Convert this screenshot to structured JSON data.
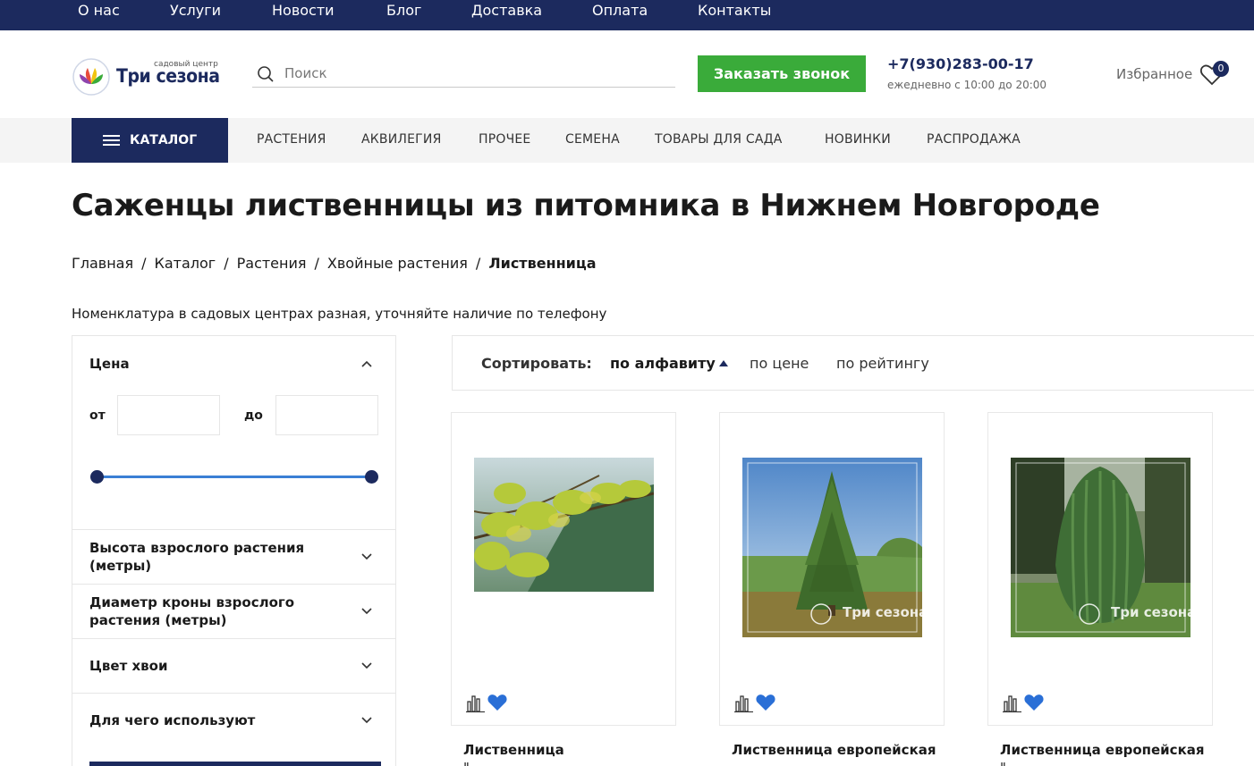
{
  "topnav": {
    "items": [
      "О нас",
      "Услуги",
      "Новости",
      "Блог",
      "Доставка",
      "Оплата",
      "Контакты"
    ]
  },
  "header": {
    "logo_small": "садовый центр",
    "logo_text": "Три сезона",
    "search_placeholder": "Поиск",
    "call_button": "Заказать звонок",
    "phone": "+7(930)283-00-17",
    "hours": "ежедневно с 10:00 до 20:00",
    "favorites_label": "Избранное",
    "favorites_count": "0"
  },
  "catbar": {
    "catalog_label": "КАТАЛОГ",
    "categories": [
      "РАСТЕНИЯ",
      "АКВИЛЕГИЯ",
      "ПРОЧЕЕ",
      "СЕМЕНА",
      "ТОВАРЫ ДЛЯ САДА",
      "НОВИНКИ",
      "РАСПРОДАЖА"
    ]
  },
  "page": {
    "title": "Саженцы лиственницы из питомника в Нижнем Новгороде",
    "breadcrumb": [
      "Главная",
      "Каталог",
      "Растения",
      "Хвойные растения",
      "Лиственница"
    ],
    "notice": "Номенклатура в садовых центрах разная, уточняйте наличие по телефону"
  },
  "filters": {
    "price_title": "Цена",
    "from_label": "от",
    "to_label": "до",
    "from_value": "",
    "to_value": "",
    "groups": [
      "Высота взрослого растения (метры)",
      "Диаметр кроны взрослого растения (метры)",
      "Цвет хвои",
      "Для чего используют"
    ]
  },
  "sort": {
    "label": "Сортировать:",
    "options": [
      "по алфавиту",
      "по цене",
      "по рейтингу"
    ],
    "active": "по алфавиту"
  },
  "products": [
    {
      "name": "Лиственница",
      "subtitle": "\"",
      "watermark": ""
    },
    {
      "name": "Лиственница европейская",
      "subtitle": "",
      "watermark": "Три сезона"
    },
    {
      "name": "Лиственница европейская",
      "subtitle": "\"",
      "watermark": "Три сезона"
    }
  ],
  "colors": {
    "navy": "#1c2a5e",
    "green": "#3aab3a",
    "accent_blue": "#3a7fd5",
    "heart_blue": "#2a6fd6"
  }
}
